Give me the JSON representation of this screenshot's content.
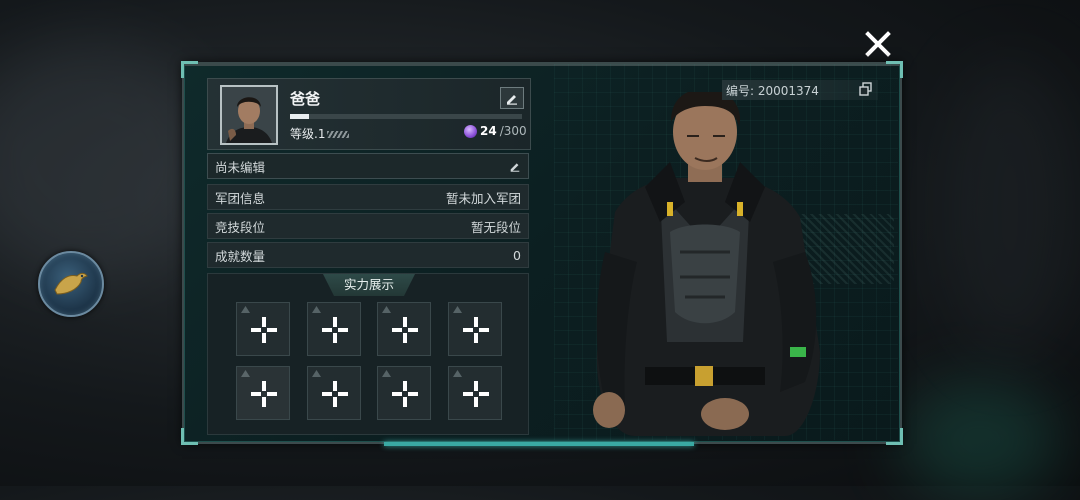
{
  "profile": {
    "name": "爸爸",
    "level_label": "等级.1",
    "xp_progress": 0.08,
    "energy_current": "24",
    "energy_max": "/300"
  },
  "player_id": "编号: 20001374",
  "rows": {
    "signature": "尚未编辑",
    "legion_label": "军团信息",
    "legion_value": "暂未加入军团",
    "rank_label": "竞技段位",
    "rank_value": "暂无段位",
    "achievements_label": "成就数量",
    "achievements_value": "0"
  },
  "showcase": {
    "title": "实力展示",
    "slot_count": 8
  },
  "icons": {
    "close": "close-x-icon",
    "edit": "pencil-icon",
    "copy": "copy-icon",
    "energy": "purple-gem-icon",
    "side": "bird-emblem-icon",
    "slot": "plus-icon"
  },
  "colors": {
    "accent": "#3aa9a3",
    "panel_bg": "#0f2a2b",
    "gem": "#8a4fd8"
  }
}
